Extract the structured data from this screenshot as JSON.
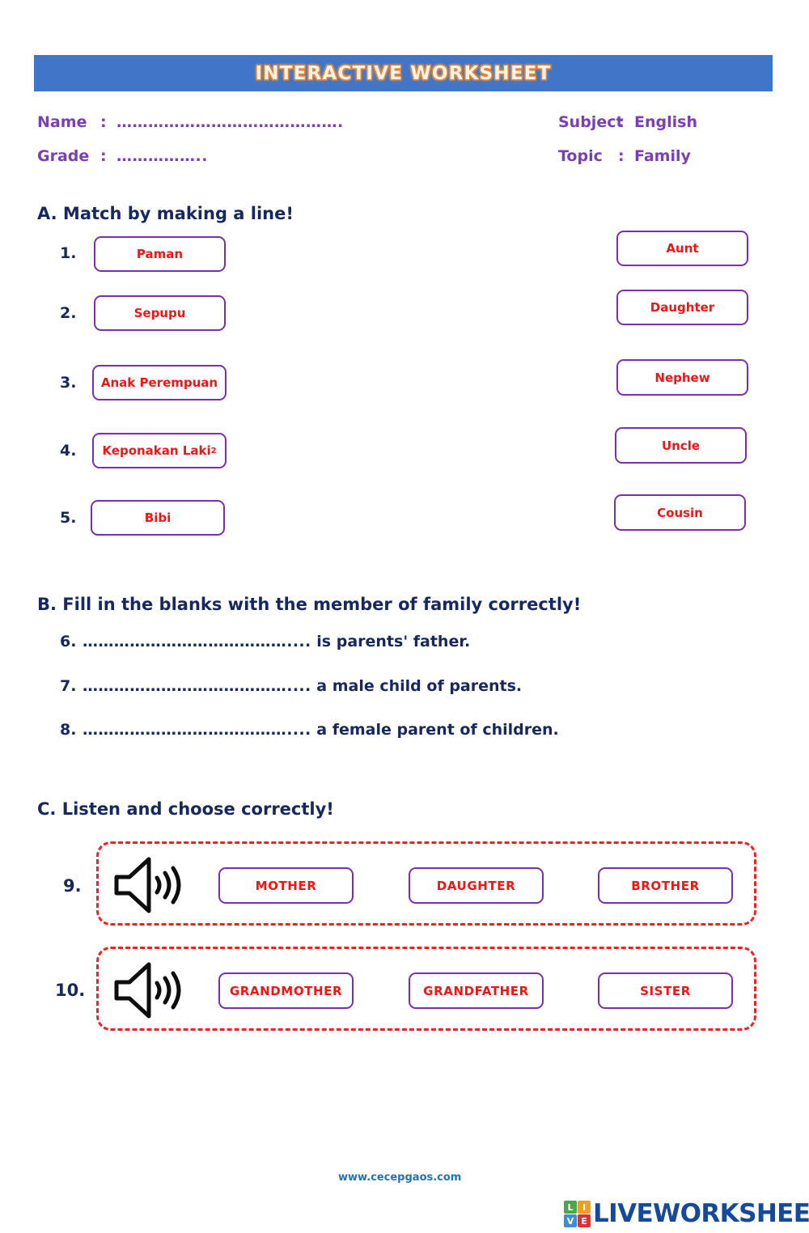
{
  "banner": {
    "title": "INTERACTIVE WORKSHEET",
    "bg_color": "#4175c7",
    "text_color": "#fdf3ea",
    "outline_color": "#e8852f"
  },
  "meta": {
    "name_label": "Name",
    "name_colon": ":",
    "name_value": "…………………………………….",
    "grade_label": "Grade",
    "grade_colon": ":",
    "grade_value": "……………..",
    "subject_label": "Subject",
    "subject_colon": ":",
    "subject_value": "English",
    "topic_label": "Topic",
    "topic_colon": ":",
    "topic_value": "Family",
    "text_color": "#7b3fb5"
  },
  "section_a": {
    "heading": "A. Match by making a line!",
    "left_items": [
      {
        "number": "1.",
        "word": "Paman"
      },
      {
        "number": "2.",
        "word": "Sepupu"
      },
      {
        "number": "3.",
        "word": "Anak Perempuan"
      },
      {
        "number": "4.",
        "word": "Keponakan Laki",
        "superscript": "2"
      },
      {
        "number": "5.",
        "word": "Bibi"
      }
    ],
    "right_items": [
      {
        "word": "Aunt"
      },
      {
        "word": "Daughter"
      },
      {
        "word": "Nephew"
      },
      {
        "word": "Uncle"
      },
      {
        "word": "Cousin"
      }
    ],
    "box_border_color": "#7b2fb0",
    "word_color": "#f41414"
  },
  "section_b": {
    "heading": "B. Fill in the blanks with the member of family correctly!",
    "items": [
      {
        "number": "6.",
        "blank": "…………………………………....",
        "text": " is parents' father."
      },
      {
        "number": "7.",
        "blank": "…………………………………....",
        "text": " a male child of parents."
      },
      {
        "number": "8.",
        "blank": "…………………………………....",
        "text": " a female parent of children."
      }
    ],
    "text_color": "#17285e"
  },
  "section_c": {
    "heading": "C. Listen and choose correctly!",
    "dashed_border_color": "#ee2222",
    "rows": [
      {
        "number": "9.",
        "audio_icon": "speaker-icon",
        "options": [
          "MOTHER",
          "DAUGHTER",
          "BROTHER"
        ]
      },
      {
        "number": "10.",
        "audio_icon": "speaker-icon",
        "options": [
          "GRANDMOTHER",
          "GRANDFATHER",
          "SISTER"
        ]
      }
    ]
  },
  "footer": {
    "url": "www.cecepgaos.com",
    "url_color": "#2372b9",
    "logo": {
      "tiles": [
        {
          "letter": "L",
          "color": "#4ca64c"
        },
        {
          "letter": "I",
          "color": "#f0a020"
        },
        {
          "letter": "V",
          "color": "#3d8ed4"
        },
        {
          "letter": "E",
          "color": "#e03030"
        }
      ],
      "wordmark": "LIVEWORKSHEETS",
      "wordmark_color": "#16489c"
    }
  }
}
